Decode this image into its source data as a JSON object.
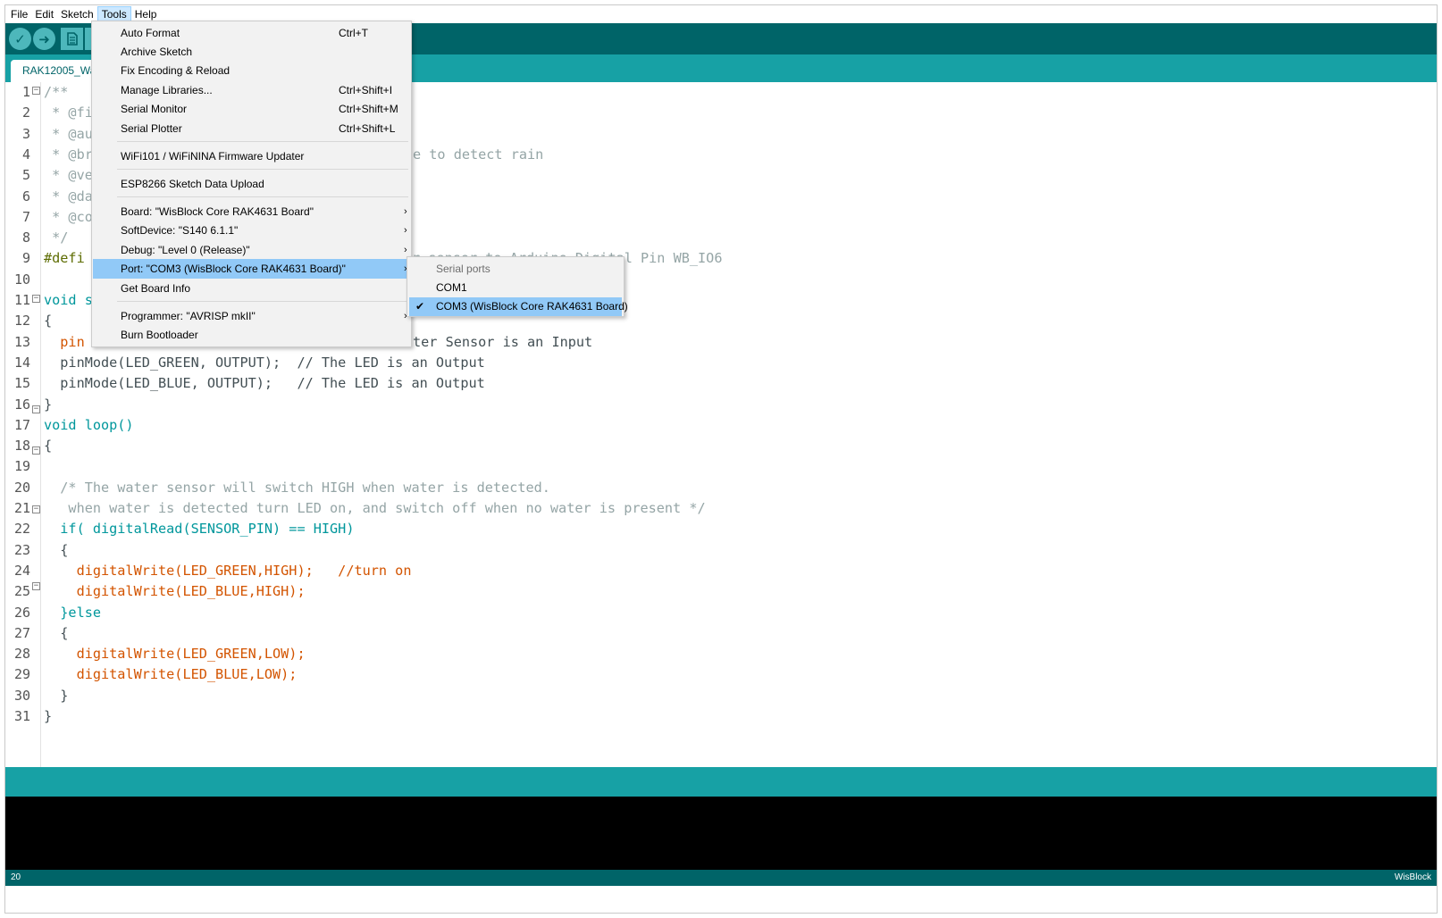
{
  "menubar": {
    "items": [
      "File",
      "Edit",
      "Sketch",
      "Tools",
      "Help"
    ]
  },
  "tab": {
    "label": "RAK12005_Wa"
  },
  "tools_menu": {
    "items": [
      {
        "label": "Auto Format",
        "shortcut": "Ctrl+T"
      },
      {
        "label": "Archive Sketch",
        "shortcut": ""
      },
      {
        "label": "Fix Encoding & Reload",
        "shortcut": ""
      },
      {
        "label": "Manage Libraries...",
        "shortcut": "Ctrl+Shift+I"
      },
      {
        "label": "Serial Monitor",
        "shortcut": "Ctrl+Shift+M"
      },
      {
        "label": "Serial Plotter",
        "shortcut": "Ctrl+Shift+L"
      },
      {
        "label": "WiFi101 / WiFiNINA Firmware Updater",
        "shortcut": ""
      },
      {
        "label": "ESP8266 Sketch Data Upload",
        "shortcut": ""
      },
      {
        "label": "Board: \"WisBlock Core RAK4631 Board\"",
        "shortcut": ""
      },
      {
        "label": "SoftDevice: \"S140 6.1.1\"",
        "shortcut": ""
      },
      {
        "label": "Debug: \"Level 0 (Release)\"",
        "shortcut": ""
      },
      {
        "label": "Port: \"COM3 (WisBlock Core RAK4631 Board)\"",
        "shortcut": ""
      },
      {
        "label": "Get Board Info",
        "shortcut": ""
      },
      {
        "label": "Programmer: \"AVRISP mkII\"",
        "shortcut": ""
      },
      {
        "label": "Burn Bootloader",
        "shortcut": ""
      }
    ]
  },
  "port_submenu": {
    "header": "Serial ports",
    "items": [
      "COM1",
      "COM3 (WisBlock Core RAK4631 Board)"
    ]
  },
  "code_lines": [
    "/**",
    " * @fi",
    " * @au",
    " * @br",
    " * @ve",
    " * @da",
    " * @co",
    " */",
    "#defi",
    "",
    "void s",
    "{",
    "  pin",
    "  pinMode(LED_GREEN, OUTPUT);  // The LED is an Output",
    "  pinMode(LED_BLUE, OUTPUT);   // The LED is an Output",
    "}",
    "void loop()",
    "{",
    "",
    "  /* The water sensor will switch HIGH when water is detected.",
    "   when water is detected turn LED on, and switch off when no water is present */",
    "  if( digitalRead(SENSOR_PIN) == HIGH)",
    "  {",
    "    digitalWrite(LED_GREEN,HIGH);   //turn on",
    "    digitalWrite(LED_BLUE,HIGH);",
    "  }else",
    "  {",
    "    digitalWrite(LED_GREEN,LOW);",
    "    digitalWrite(LED_BLUE,LOW);",
    "  }",
    "}"
  ],
  "code_fragments": {
    "line4_tail": "e to detect rain",
    "line9_tail": "r sensor to Arduino Digital Pin WB_IO6",
    "line13_tail": "ter Sensor is an Input"
  },
  "footer": {
    "line_number": "20",
    "board": "WisBlock"
  },
  "colors": {
    "toolbar": "#006468",
    "tabbar": "#17a1a5",
    "menu_highlight": "#91c9f7",
    "keyword": "#00979c",
    "function": "#d35400",
    "comment": "#95a5a6"
  }
}
